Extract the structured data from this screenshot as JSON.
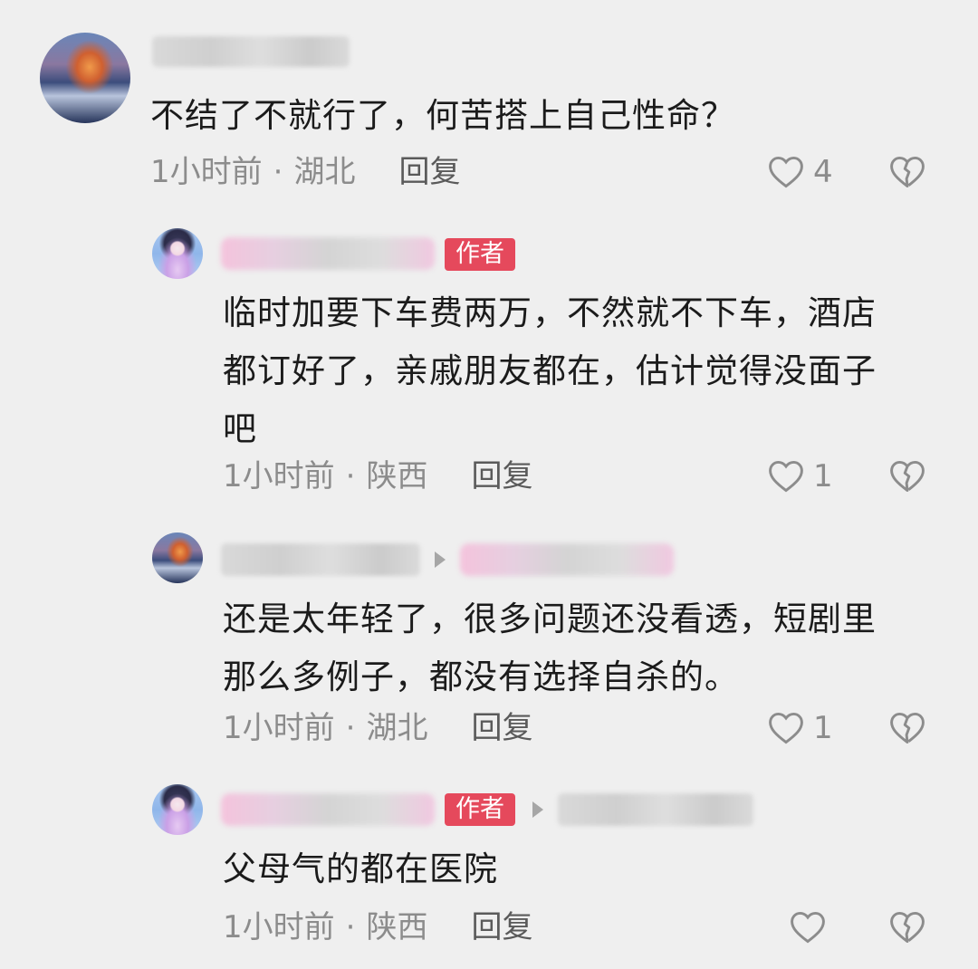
{
  "comments": [
    {
      "text": "不结了不就行了，何苦搭上自己性命？",
      "time": "1小时前",
      "location": "湖北",
      "reply": "回复",
      "likes": "4"
    },
    {
      "badge": "作者",
      "text": "临时加要下车费两万，不然就不下车，酒店\n都订好了，亲戚朋友都在，估计觉得没面子\n吧",
      "time": "1小时前",
      "location": "陕西",
      "reply": "回复",
      "likes": "1"
    },
    {
      "text": "还是太年轻了，很多问题还没看透，短剧里\n那么多例子，都没有选择自杀的。",
      "time": "1小时前",
      "location": "湖北",
      "reply": "回复",
      "likes": "1"
    },
    {
      "badge": "作者",
      "text": "父母气的都在医院",
      "time": "1小时前",
      "location": "陕西",
      "reply": "回复",
      "likes": ""
    }
  ],
  "separator": "·",
  "icons": {
    "like": "heart-outline-icon",
    "dislike": "broken-heart-icon",
    "reply_arrow": "triangle-right-icon"
  },
  "colors": {
    "background": "#efefef",
    "badge": "#e5495c",
    "meta": "#8c8c8c"
  }
}
